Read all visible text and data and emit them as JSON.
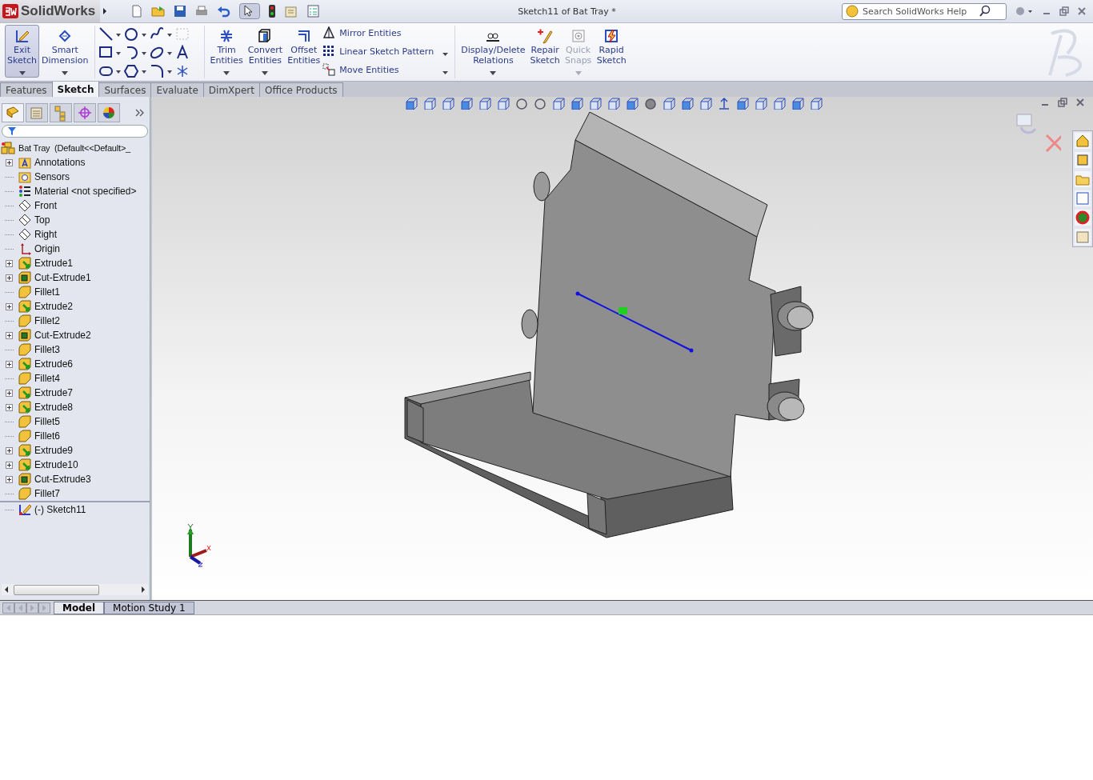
{
  "app": {
    "logo": "SolidWorks"
  },
  "window": {
    "title": "Sketch11 of Bat Tray *"
  },
  "search": {
    "placeholder": "Search SolidWorks Help"
  },
  "ribbon": {
    "tools_left": [
      {
        "label": "Exit Sketch",
        "active": true,
        "disabled": false
      },
      {
        "label": "Smart Dimension",
        "active": false,
        "disabled": false
      }
    ],
    "tools_mid": [
      {
        "label": "Trim Entities",
        "active": false,
        "disabled": false
      },
      {
        "label": "Convert Entities",
        "active": false,
        "disabled": false
      },
      {
        "label": "Offset Entities",
        "active": false,
        "disabled": false
      }
    ],
    "list": [
      {
        "label": "Mirror Entities"
      },
      {
        "label": "Linear Sketch Pattern"
      },
      {
        "label": "Move Entities"
      }
    ],
    "tools_right": [
      {
        "label": "Display/Delete Relations",
        "active": false,
        "disabled": false
      },
      {
        "label": "Repair Sketch",
        "active": false,
        "disabled": false
      },
      {
        "label": "Quick Snaps",
        "active": false,
        "disabled": true
      },
      {
        "label": "Rapid Sketch",
        "active": false,
        "disabled": false
      }
    ]
  },
  "command_tabs": [
    {
      "label": "Features",
      "selected": false
    },
    {
      "label": "Sketch",
      "selected": true
    },
    {
      "label": "Surfaces",
      "selected": false
    },
    {
      "label": "Evaluate",
      "selected": false
    },
    {
      "label": "DimXpert",
      "selected": false
    },
    {
      "label": "Office Products",
      "selected": false
    }
  ],
  "feature_tree": {
    "root": {
      "label": "Bat Tray  (Default<<Default>_",
      "children": [
        {
          "label": "Annotations",
          "kind": "annotations",
          "expanded": false
        },
        {
          "label": "Sensors",
          "kind": "sensors"
        },
        {
          "label": "Material <not specified>",
          "kind": "material"
        },
        {
          "label": "Front",
          "kind": "plane"
        },
        {
          "label": "Top",
          "kind": "plane"
        },
        {
          "label": "Right",
          "kind": "plane"
        },
        {
          "label": "Origin",
          "kind": "origin"
        },
        {
          "label": "Extrude1",
          "kind": "extrude",
          "expanded": false
        },
        {
          "label": "Cut-Extrude1",
          "kind": "cut",
          "expanded": false
        },
        {
          "label": "Fillet1",
          "kind": "fillet"
        },
        {
          "label": "Extrude2",
          "kind": "extrude",
          "expanded": false
        },
        {
          "label": "Fillet2",
          "kind": "fillet"
        },
        {
          "label": "Cut-Extrude2",
          "kind": "cut",
          "expanded": false
        },
        {
          "label": "Fillet3",
          "kind": "fillet"
        },
        {
          "label": "Extrude6",
          "kind": "extrude",
          "expanded": false
        },
        {
          "label": "Fillet4",
          "kind": "fillet"
        },
        {
          "label": "Extrude7",
          "kind": "extrude",
          "expanded": false
        },
        {
          "label": "Extrude8",
          "kind": "extrude",
          "expanded": false
        },
        {
          "label": "Fillet5",
          "kind": "fillet"
        },
        {
          "label": "Fillet6",
          "kind": "fillet"
        },
        {
          "label": "Extrude9",
          "kind": "extrude",
          "expanded": false
        },
        {
          "label": "Extrude10",
          "kind": "extrude",
          "expanded": false
        },
        {
          "label": "Cut-Extrude3",
          "kind": "cut",
          "expanded": false
        },
        {
          "label": "Fillet7",
          "kind": "fillet"
        },
        {
          "label": "(-) Sketch11",
          "kind": "sketch"
        }
      ]
    }
  },
  "bottom_tabs": [
    {
      "label": "Model",
      "selected": true
    },
    {
      "label": "Motion Study 1",
      "selected": false
    }
  ]
}
